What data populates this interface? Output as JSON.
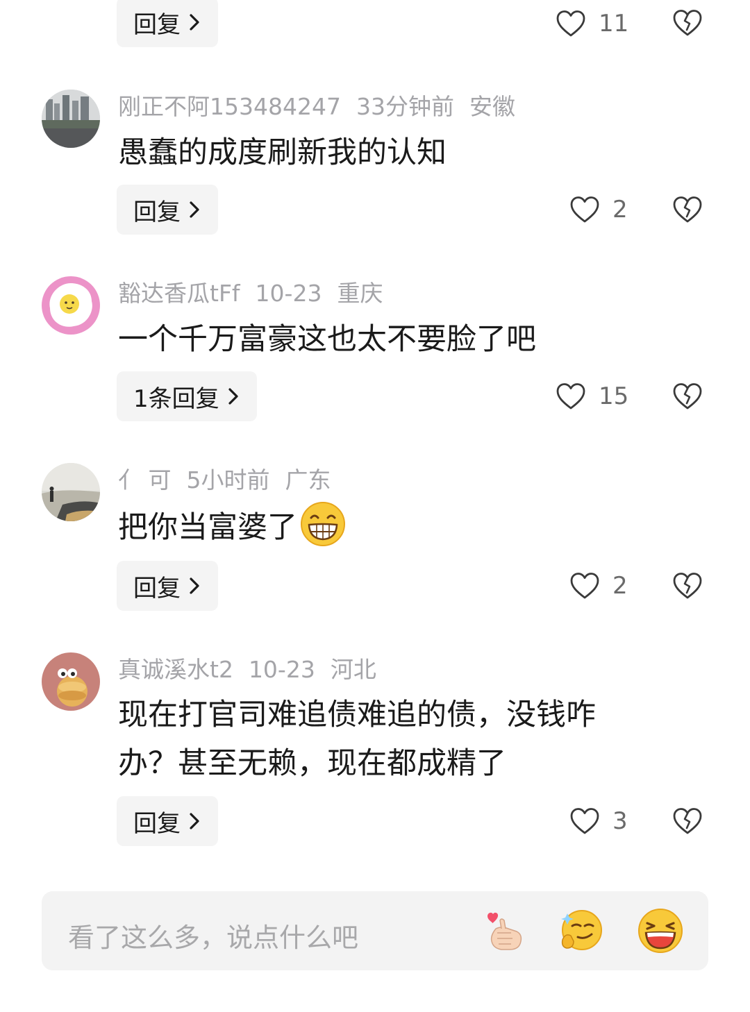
{
  "reply_label": "回复",
  "top_partial": {
    "reply_label": "回复",
    "likes": "11"
  },
  "comments": [
    {
      "username": "刚正不阿153484247",
      "time": "33分钟前",
      "location": "安徽",
      "text": "愚蠢的成度刷新我的认知",
      "reply_label": "回复",
      "likes": "2",
      "avatar": "city-photo-avatar"
    },
    {
      "username": "豁达香瓜tFf",
      "time": "10-23",
      "location": "重庆",
      "text": "一个千万富豪这也太不要脸了吧",
      "reply_label": "1条回复",
      "likes": "15",
      "avatar": "fried-egg-avatar"
    },
    {
      "username": "亻 可",
      "time": "5小时前",
      "location": "广东",
      "text": "把你当富婆了",
      "emoji": "grinning-face-emoji",
      "reply_label": "回复",
      "likes": "2",
      "avatar": "landscape-person-avatar"
    },
    {
      "username": "真诚溪水t2",
      "time": "10-23",
      "location": "河北",
      "text_line1": "现在打官司难追债难追的债，没钱咋",
      "text_line2": "办？甚至无赖，现在都成精了",
      "reply_label": "回复",
      "likes": "3",
      "avatar": "cartoon-burger-avatar"
    }
  ],
  "input": {
    "placeholder": "看了这么多，说点什么吧",
    "emojis": [
      "finger-heart-emoji",
      "smirk-thumbs-emoji",
      "laughing-emoji"
    ]
  },
  "colors": {
    "meta_text": "#a4a4a8",
    "body_text": "#1a1a1a",
    "button_bg": "#f4f4f4",
    "icon_stroke": "#3a3a3a"
  }
}
